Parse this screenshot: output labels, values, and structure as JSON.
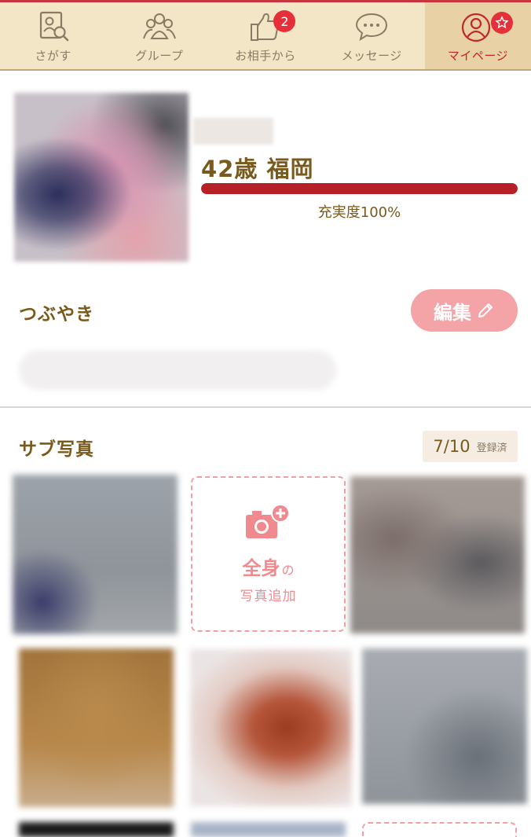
{
  "tabs": [
    {
      "label": "さがす",
      "icon": "profile-search-icon",
      "active": false
    },
    {
      "label": "グループ",
      "icon": "group-icon",
      "active": false
    },
    {
      "label": "お相手から",
      "icon": "thumbs-up-icon",
      "active": false,
      "badge": "2"
    },
    {
      "label": "メッセージ",
      "icon": "message-bubble-icon",
      "active": false
    },
    {
      "label": "マイページ",
      "icon": "user-circle-icon",
      "active": true,
      "badge_icon": "star-icon"
    }
  ],
  "profile": {
    "age_location": "42歳 福岡",
    "completion_percent": 100,
    "completion_label": "充実度100%"
  },
  "tweet": {
    "title": "つぶやき",
    "edit_label": "編集"
  },
  "sub_photos": {
    "title": "サブ写真",
    "count": "7/10",
    "registered_label": "登録済",
    "add_main": "全身",
    "add_suffix": "の",
    "add_sub": "写真追加"
  },
  "colors": {
    "accent_red": "#b52126",
    "badge_red": "#e5303a",
    "pink": "#f4a3a6",
    "brown_text": "#7a5a1c",
    "tab_bg": "#f3e6c7"
  }
}
